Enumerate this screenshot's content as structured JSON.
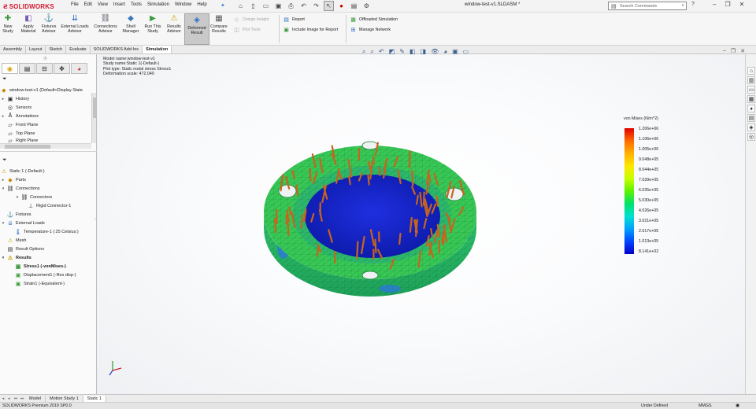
{
  "titlebar": {
    "brand": "SOLIDWORKS",
    "menus": [
      "File",
      "Edit",
      "View",
      "Insert",
      "Tools",
      "Simulation",
      "Window",
      "Help"
    ],
    "document_title": "window-test-v1.SLDASM *",
    "search_placeholder": "Search Commands"
  },
  "ribbon": {
    "new_study": "New Study",
    "apply_material": "Apply Material",
    "fixtures_advisor": "Fixtures Advisor",
    "external_loads_advisor": "External Loads Advisor",
    "connections_advisor": "Connections Advisor",
    "shell_manager": "Shell Manager",
    "run_this_study": "Run This Study",
    "results_advisor": "Results Advisor",
    "deformed_result": "Deformed Result",
    "compare_results": "Compare Results",
    "design_insight": "Design Insight",
    "plot_tools": "Plot Tools",
    "report": "Report",
    "include_image": "Include Image for Report",
    "offloaded_simulation": "Offloaded Simulation",
    "manage_network": "Manage Network"
  },
  "command_tabs": [
    "Assembly",
    "Layout",
    "Sketch",
    "Evaluate",
    "SOLIDWORKS Add-Ins",
    "Simulation"
  ],
  "feature_tree": {
    "root": "window-test-v1  (Default<Display State",
    "items": [
      "History",
      "Sensors",
      "Annotations",
      "Front Plane",
      "Top Plane",
      "Right Plane"
    ]
  },
  "study_tree": {
    "study": "Static 1 (-Default-)",
    "parts": "Parts",
    "connections": "Connections",
    "connectors": "Connectors",
    "rigid_connector": "Rigid Connector-1",
    "fixtures": "Fixtures",
    "external_loads": "External Loads",
    "temperature": "Temperature-1 (:25 Celsius:)",
    "mesh": "Mesh",
    "result_options": "Result Options",
    "results": "Results",
    "stress": "Stress1 (-vonMises-)",
    "displacement": "Displacement1 (-Res disp-)",
    "strain": "Strain1 (-Equivalent-)"
  },
  "viewport": {
    "info_lines": [
      "Model name:window-test-v1",
      "Study name:Static 1(-Default-)",
      "Plot type: Static nodal stress Stress1",
      "Deformation scale: 472,040"
    ]
  },
  "legend": {
    "title": "von Mises (N/m^2)",
    "labels": [
      "1.206e+06",
      "1.106e+06",
      "1.005e+06",
      "9.048e+05",
      "8.044e+05",
      "7.039e+05",
      "6.035e+05",
      "5.030e+05",
      "4.026e+05",
      "3.021e+05",
      "2.017e+05",
      "1.013e+05",
      "8.141e+02"
    ],
    "colors": [
      "#e00000",
      "#ffe600",
      "#5ef200",
      "#00e0d0",
      "#0000c8"
    ]
  },
  "bottom_tabs": [
    "Model",
    "Motion Study 1",
    "Static 1"
  ],
  "status": {
    "product": "SOLIDWORKS Premium 2019 SP0.0",
    "definition": "Under Defined",
    "units": "MMGS"
  }
}
